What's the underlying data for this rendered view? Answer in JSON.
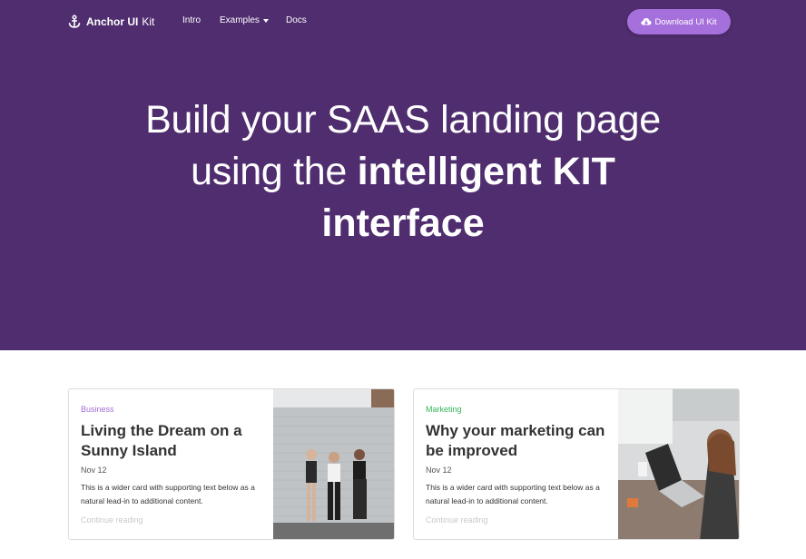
{
  "nav": {
    "brand_bold": "Anchor UI",
    "brand_light": "Kit",
    "links": [
      "Intro",
      "Examples",
      "Docs"
    ],
    "download_label": "Download UI Kit"
  },
  "hero": {
    "line1": "Build your SAAS landing page",
    "line2_light": "using the ",
    "line2_strong": "intelligent KIT",
    "line3_strong": "interface"
  },
  "cards": [
    {
      "category": "Business",
      "title": "Living the Dream on a Sunny Island",
      "date": "Nov 12",
      "text": "This is a wider card with supporting text below as a natural lead-in to additional content.",
      "link": "Continue reading"
    },
    {
      "category": "Marketing",
      "title": "Why your marketing can be improved",
      "date": "Nov 12",
      "text": "This is a wider card with supporting text below as a natural lead-in to additional content.",
      "link": "Continue reading"
    }
  ],
  "colors": {
    "hero_bg": "#4f2d6e",
    "button_bg": "#a670dc",
    "business": "#a56bd8",
    "marketing": "#35b558"
  }
}
